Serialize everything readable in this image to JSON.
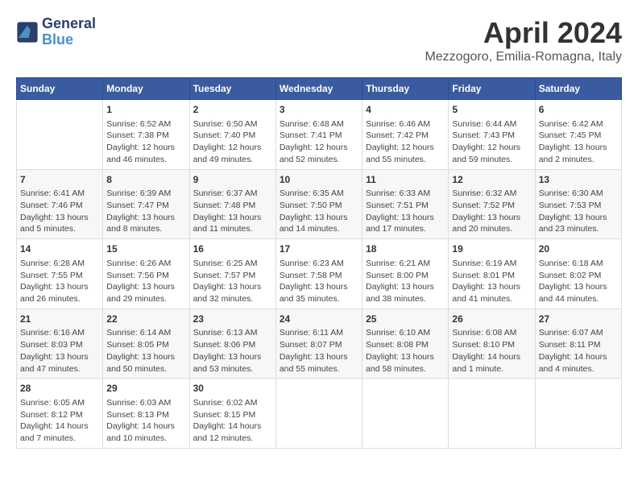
{
  "logo": {
    "line1": "General",
    "line2": "Blue"
  },
  "title": "April 2024",
  "subtitle": "Mezzogoro, Emilia-Romagna, Italy",
  "days_of_week": [
    "Sunday",
    "Monday",
    "Tuesday",
    "Wednesday",
    "Thursday",
    "Friday",
    "Saturday"
  ],
  "weeks": [
    [
      {
        "day": "",
        "info": ""
      },
      {
        "day": "1",
        "info": "Sunrise: 6:52 AM\nSunset: 7:38 PM\nDaylight: 12 hours\nand 46 minutes."
      },
      {
        "day": "2",
        "info": "Sunrise: 6:50 AM\nSunset: 7:40 PM\nDaylight: 12 hours\nand 49 minutes."
      },
      {
        "day": "3",
        "info": "Sunrise: 6:48 AM\nSunset: 7:41 PM\nDaylight: 12 hours\nand 52 minutes."
      },
      {
        "day": "4",
        "info": "Sunrise: 6:46 AM\nSunset: 7:42 PM\nDaylight: 12 hours\nand 55 minutes."
      },
      {
        "day": "5",
        "info": "Sunrise: 6:44 AM\nSunset: 7:43 PM\nDaylight: 12 hours\nand 59 minutes."
      },
      {
        "day": "6",
        "info": "Sunrise: 6:42 AM\nSunset: 7:45 PM\nDaylight: 13 hours\nand 2 minutes."
      }
    ],
    [
      {
        "day": "7",
        "info": "Sunrise: 6:41 AM\nSunset: 7:46 PM\nDaylight: 13 hours\nand 5 minutes."
      },
      {
        "day": "8",
        "info": "Sunrise: 6:39 AM\nSunset: 7:47 PM\nDaylight: 13 hours\nand 8 minutes."
      },
      {
        "day": "9",
        "info": "Sunrise: 6:37 AM\nSunset: 7:48 PM\nDaylight: 13 hours\nand 11 minutes."
      },
      {
        "day": "10",
        "info": "Sunrise: 6:35 AM\nSunset: 7:50 PM\nDaylight: 13 hours\nand 14 minutes."
      },
      {
        "day": "11",
        "info": "Sunrise: 6:33 AM\nSunset: 7:51 PM\nDaylight: 13 hours\nand 17 minutes."
      },
      {
        "day": "12",
        "info": "Sunrise: 6:32 AM\nSunset: 7:52 PM\nDaylight: 13 hours\nand 20 minutes."
      },
      {
        "day": "13",
        "info": "Sunrise: 6:30 AM\nSunset: 7:53 PM\nDaylight: 13 hours\nand 23 minutes."
      }
    ],
    [
      {
        "day": "14",
        "info": "Sunrise: 6:28 AM\nSunset: 7:55 PM\nDaylight: 13 hours\nand 26 minutes."
      },
      {
        "day": "15",
        "info": "Sunrise: 6:26 AM\nSunset: 7:56 PM\nDaylight: 13 hours\nand 29 minutes."
      },
      {
        "day": "16",
        "info": "Sunrise: 6:25 AM\nSunset: 7:57 PM\nDaylight: 13 hours\nand 32 minutes."
      },
      {
        "day": "17",
        "info": "Sunrise: 6:23 AM\nSunset: 7:58 PM\nDaylight: 13 hours\nand 35 minutes."
      },
      {
        "day": "18",
        "info": "Sunrise: 6:21 AM\nSunset: 8:00 PM\nDaylight: 13 hours\nand 38 minutes."
      },
      {
        "day": "19",
        "info": "Sunrise: 6:19 AM\nSunset: 8:01 PM\nDaylight: 13 hours\nand 41 minutes."
      },
      {
        "day": "20",
        "info": "Sunrise: 6:18 AM\nSunset: 8:02 PM\nDaylight: 13 hours\nand 44 minutes."
      }
    ],
    [
      {
        "day": "21",
        "info": "Sunrise: 6:16 AM\nSunset: 8:03 PM\nDaylight: 13 hours\nand 47 minutes."
      },
      {
        "day": "22",
        "info": "Sunrise: 6:14 AM\nSunset: 8:05 PM\nDaylight: 13 hours\nand 50 minutes."
      },
      {
        "day": "23",
        "info": "Sunrise: 6:13 AM\nSunset: 8:06 PM\nDaylight: 13 hours\nand 53 minutes."
      },
      {
        "day": "24",
        "info": "Sunrise: 6:11 AM\nSunset: 8:07 PM\nDaylight: 13 hours\nand 55 minutes."
      },
      {
        "day": "25",
        "info": "Sunrise: 6:10 AM\nSunset: 8:08 PM\nDaylight: 13 hours\nand 58 minutes."
      },
      {
        "day": "26",
        "info": "Sunrise: 6:08 AM\nSunset: 8:10 PM\nDaylight: 14 hours\nand 1 minute."
      },
      {
        "day": "27",
        "info": "Sunrise: 6:07 AM\nSunset: 8:11 PM\nDaylight: 14 hours\nand 4 minutes."
      }
    ],
    [
      {
        "day": "28",
        "info": "Sunrise: 6:05 AM\nSunset: 8:12 PM\nDaylight: 14 hours\nand 7 minutes."
      },
      {
        "day": "29",
        "info": "Sunrise: 6:03 AM\nSunset: 8:13 PM\nDaylight: 14 hours\nand 10 minutes."
      },
      {
        "day": "30",
        "info": "Sunrise: 6:02 AM\nSunset: 8:15 PM\nDaylight: 14 hours\nand 12 minutes."
      },
      {
        "day": "",
        "info": ""
      },
      {
        "day": "",
        "info": ""
      },
      {
        "day": "",
        "info": ""
      },
      {
        "day": "",
        "info": ""
      }
    ]
  ]
}
